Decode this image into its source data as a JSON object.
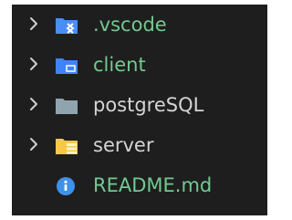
{
  "explorer": {
    "items": [
      {
        "label": ".vscode",
        "kind": "folder",
        "icon": "vscode-folder-icon",
        "icon_color": "#4a8df5",
        "label_color": "#73c991",
        "collapsed": true
      },
      {
        "label": "client",
        "kind": "folder",
        "icon": "client-folder-icon",
        "icon_color": "#3f84f7",
        "label_color": "#73c991",
        "collapsed": true
      },
      {
        "label": "postgreSQL",
        "kind": "folder",
        "icon": "folder-icon",
        "icon_color": "#90a4ae",
        "label_color": "#d4d4d4",
        "collapsed": true
      },
      {
        "label": "server",
        "kind": "folder",
        "icon": "server-folder-icon",
        "icon_color": "#f7c948",
        "label_color": "#d4d4d4",
        "collapsed": true
      },
      {
        "label": "README.md",
        "kind": "file",
        "icon": "info-icon",
        "icon_color": "#3f91e8",
        "label_color": "#73c991"
      }
    ]
  }
}
